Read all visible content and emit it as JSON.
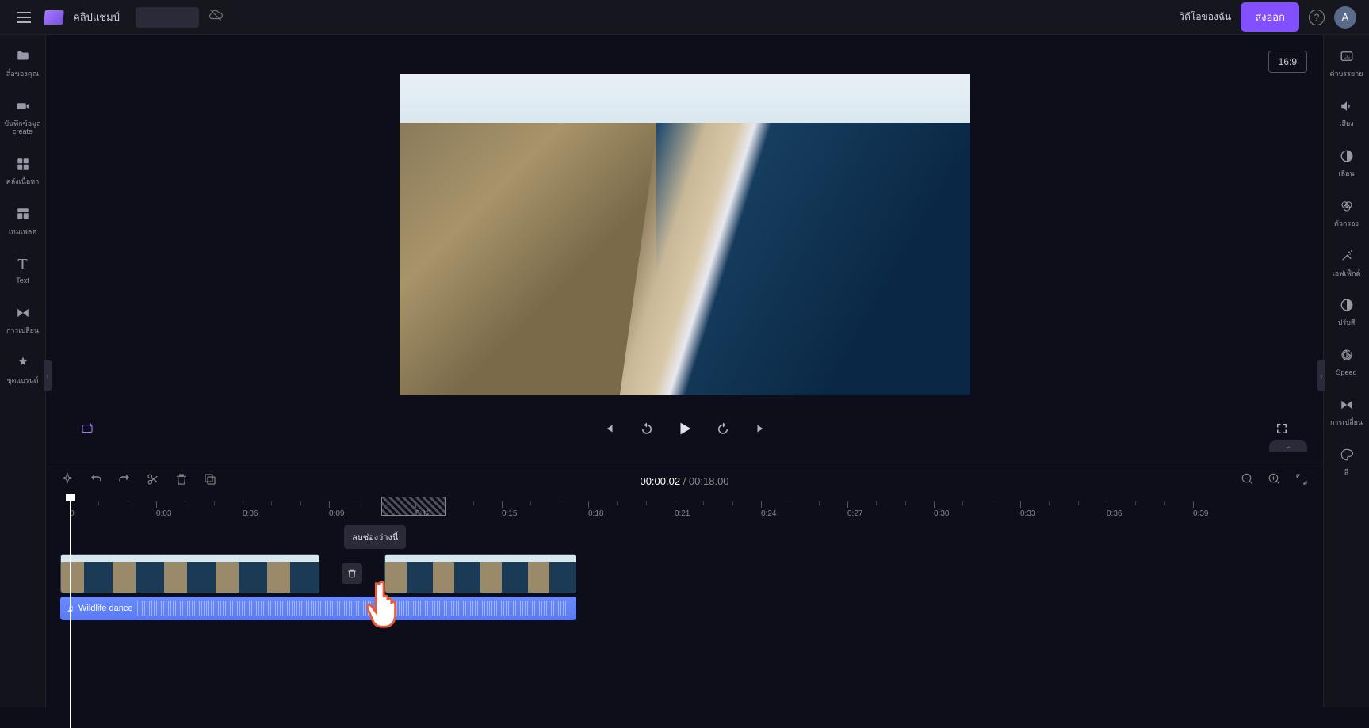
{
  "header": {
    "project_title": "คลิปแชมป์",
    "videos_link": "วิดีโอของฉัน",
    "export_label": "ส่งออก",
    "avatar_letter": "A"
  },
  "left_sidebar": {
    "items": [
      {
        "icon": "folder-icon",
        "label": "สื่อของคุณ"
      },
      {
        "icon": "camera-icon",
        "label": "บันทึกข้อมูล\ncreate"
      },
      {
        "icon": "library-icon",
        "label": "คลังเนื้อหา"
      },
      {
        "icon": "template-icon",
        "label": "เทมเพลต"
      },
      {
        "icon": "text-icon",
        "label": "Text"
      },
      {
        "icon": "transition-icon",
        "label": "การเปลี่ยน"
      },
      {
        "icon": "brand-icon",
        "label": "ชุดแบรนด์"
      }
    ]
  },
  "right_sidebar": {
    "items": [
      {
        "icon": "captions-icon",
        "label": "คำบรรยาย"
      },
      {
        "icon": "audio-icon",
        "label": "เสียง"
      },
      {
        "icon": "fade-icon",
        "label": "เลือน"
      },
      {
        "icon": "filter-icon",
        "label": "ตัวกรอง"
      },
      {
        "icon": "effects-icon",
        "label": "เอฟเฟ็กต์"
      },
      {
        "icon": "adjust-icon",
        "label": "ปรับสี"
      },
      {
        "icon": "speed-icon",
        "label": "Speed"
      },
      {
        "icon": "transition-icon",
        "label": "การเปลี่ยน"
      },
      {
        "icon": "color-icon",
        "label": "สี"
      }
    ]
  },
  "preview": {
    "aspect_ratio": "16:9"
  },
  "timeline": {
    "current_time": "00:00.02",
    "total_time": "00:18.00",
    "separator": " / ",
    "ticks": [
      "0",
      "0:03",
      "0:06",
      "0:09",
      "0:12",
      "0:15",
      "0:18",
      "0:21",
      "0:24",
      "0:27",
      "0:30",
      "0:33",
      "0:36",
      "0:39"
    ],
    "tooltip": "ลบช่องว่างนี้",
    "audio_clip_name": "Wildlife dance"
  }
}
